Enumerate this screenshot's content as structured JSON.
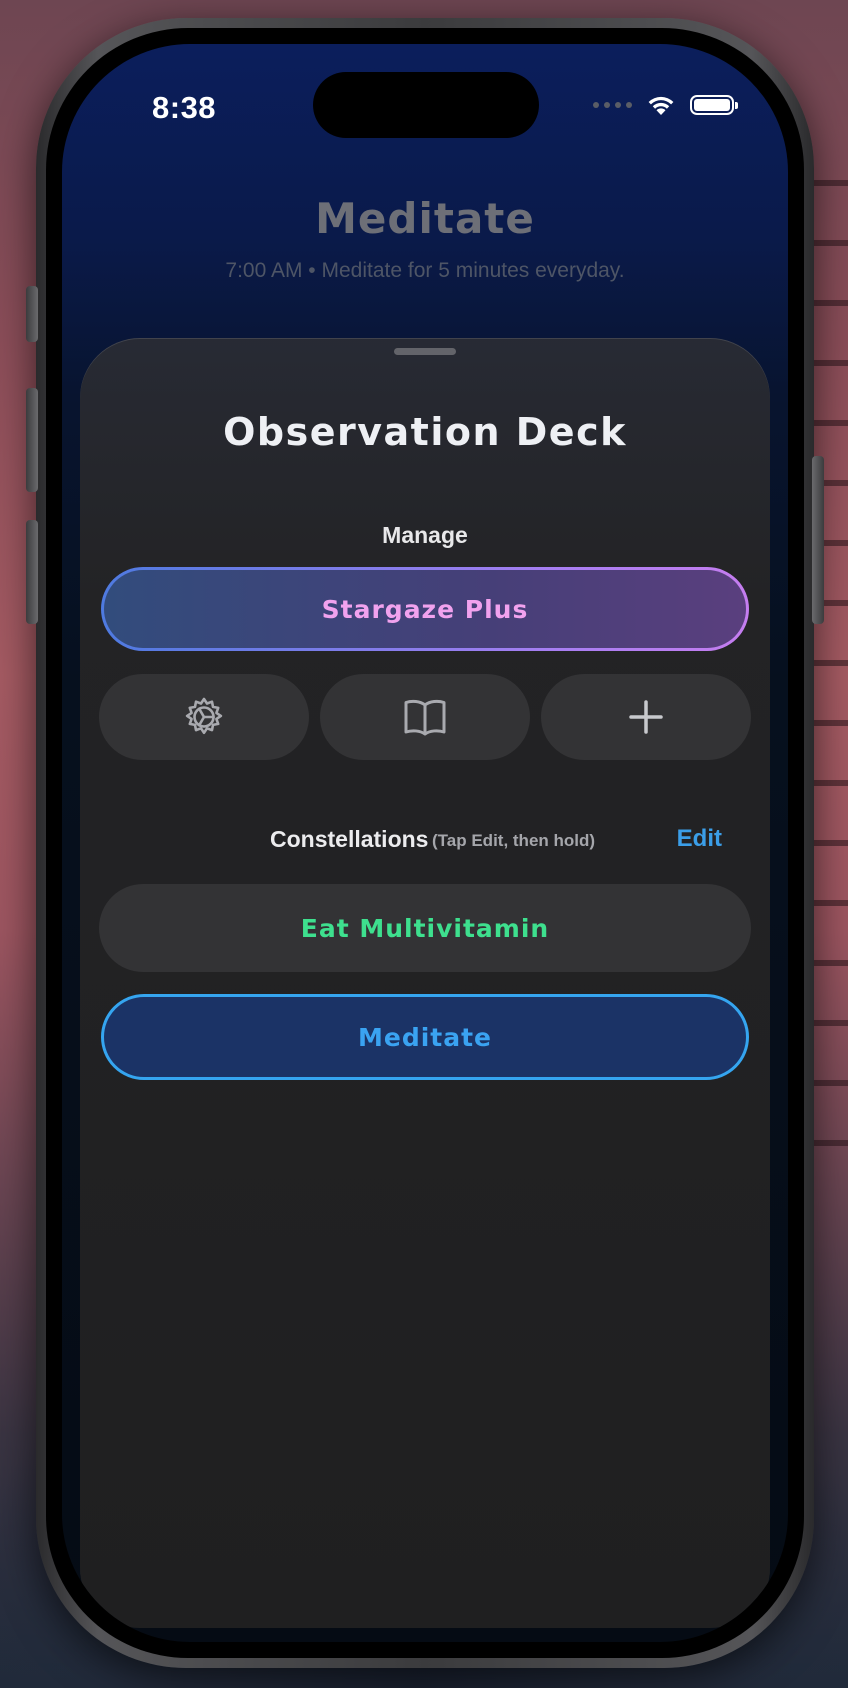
{
  "status_bar": {
    "time": "8:38"
  },
  "background_page": {
    "title": "Meditate",
    "subtitle": "7:00 AM • Meditate for 5 minutes everyday."
  },
  "sheet": {
    "title": "Observation Deck",
    "manage_label": "Manage",
    "upgrade_button": "Stargaze Plus",
    "icon_buttons": [
      {
        "icon": "gear-icon"
      },
      {
        "icon": "book-icon"
      },
      {
        "icon": "plus-icon"
      }
    ],
    "constellations": {
      "title": "Constellations",
      "hint": "(Tap Edit, then hold)",
      "edit_label": "Edit",
      "items": [
        {
          "label": "Eat Multivitamin",
          "color": "#3ee08e"
        },
        {
          "label": "Meditate",
          "color": "#3aa3f2"
        }
      ]
    }
  },
  "colors": {
    "accent_blue": "#3b9ee8",
    "accent_pink": "#f1a2ee",
    "accent_green": "#3ee08e"
  }
}
